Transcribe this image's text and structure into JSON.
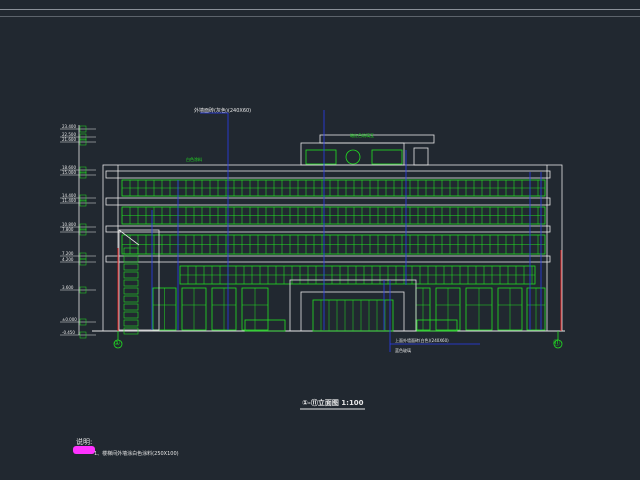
{
  "drawing": {
    "title": "①-⑪立面图 1:100",
    "axis_left": "①",
    "axis_right": "⑪",
    "top_note": "外墙面砖(灰色)(240X60)",
    "roof_label": "暗红色琉璃瓦",
    "band_label": "白色涂料",
    "bottom_note_1": "上面外墙面砖(白色)(240X60)",
    "bottom_note_2": "蓝色玻璃",
    "notes_heading": "说明:",
    "notes_item_1": "1、楼梯间外墙涂白色涂料(250X100)"
  },
  "elevations": [
    "23.400",
    "22.500",
    "21.600",
    "18.600",
    "15.000",
    "14.400",
    "11.400",
    "10.800",
    "7.800",
    "7.200",
    "4.200",
    "3.600",
    "±0.000",
    "-0.450"
  ],
  "colors": {
    "background": "#212830",
    "line_green": "#22e022",
    "line_white": "#e8e8e8",
    "line_blue": "#2a3cf0",
    "line_red": "#e02020",
    "highlight_magenta": "#ff33ff"
  }
}
